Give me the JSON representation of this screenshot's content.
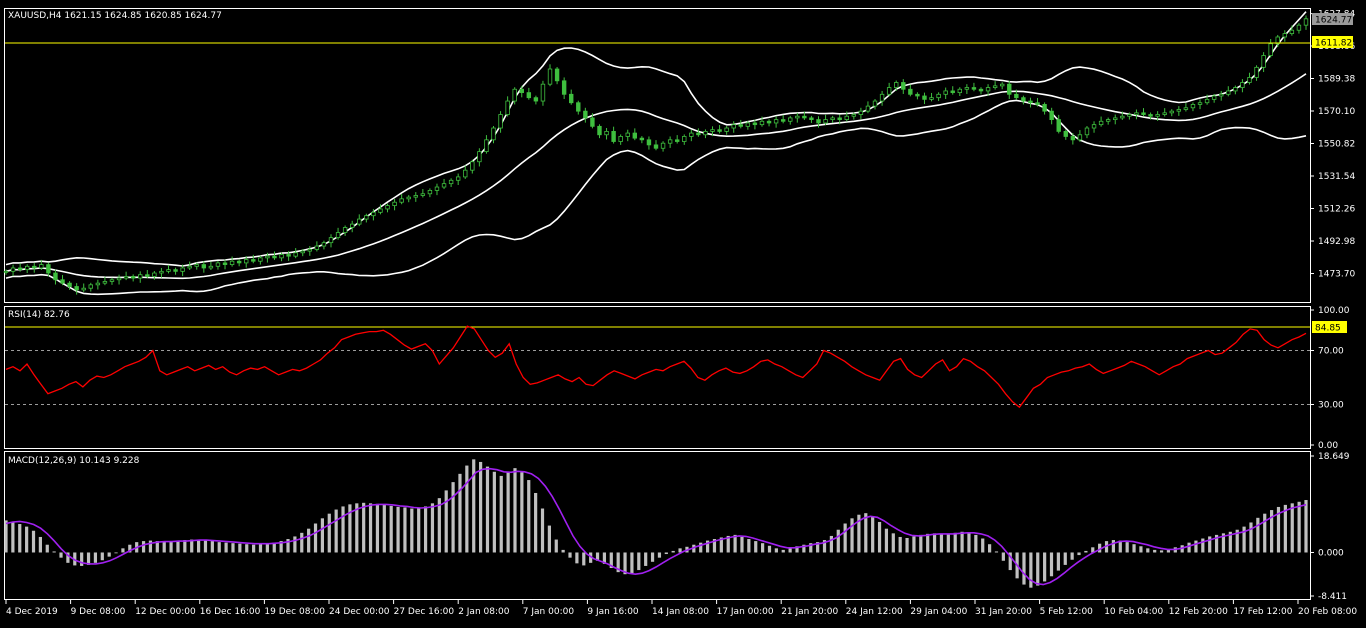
{
  "colors": {
    "background": "#000000",
    "candle": "#3fbf3f",
    "bands": "#ffffff",
    "rsi_line": "#ff0000",
    "level_line": "#ffff00",
    "macd_signal": "#a020f0",
    "macd_hist": "#c0c0c0"
  },
  "chart_data": [
    {
      "type": "candlestick",
      "title": "XAUUSD,H4  1621.15 1624.85 1620.85 1624.77",
      "last_price_label": "1624.77",
      "level_label": "1611.82",
      "yticks": [
        "1627.84",
        "1608.66",
        "1589.38",
        "1570.10",
        "1550.82",
        "1531.54",
        "1512.26",
        "1492.98",
        "1473.70"
      ],
      "ylim": [
        1458,
        1630
      ],
      "indicators": [
        "Bollinger Bands (upper, middle, lower)"
      ],
      "close": [
        1475,
        1477,
        1476,
        1478,
        1477,
        1479,
        1474,
        1470,
        1468,
        1466,
        1464,
        1465,
        1467,
        1468,
        1469,
        1470,
        1471,
        1472,
        1471,
        1473,
        1472,
        1474,
        1475,
        1476,
        1475,
        1477,
        1478,
        1479,
        1477,
        1478,
        1480,
        1479,
        1481,
        1480,
        1482,
        1481,
        1483,
        1484,
        1483,
        1485,
        1484,
        1486,
        1487,
        1488,
        1490,
        1492,
        1495,
        1498,
        1501,
        1503,
        1506,
        1508,
        1510,
        1512,
        1514,
        1516,
        1518,
        1519,
        1520,
        1521,
        1523,
        1525,
        1527,
        1529,
        1531,
        1535,
        1540,
        1546,
        1553,
        1560,
        1568,
        1576,
        1583,
        1581,
        1578,
        1576,
        1586,
        1595,
        1588,
        1580,
        1575,
        1570,
        1566,
        1561,
        1556,
        1558,
        1552,
        1555,
        1557,
        1554,
        1553,
        1550,
        1548,
        1551,
        1553,
        1552,
        1555,
        1557,
        1556,
        1558,
        1559,
        1558,
        1560,
        1562,
        1561,
        1563,
        1562,
        1564,
        1563,
        1565,
        1564,
        1566,
        1567,
        1566,
        1565,
        1563,
        1565,
        1566,
        1565,
        1567,
        1568,
        1570,
        1573,
        1576,
        1580,
        1584,
        1587,
        1583,
        1580,
        1579,
        1577,
        1578,
        1580,
        1582,
        1581,
        1583,
        1584,
        1583,
        1582,
        1584,
        1585,
        1586,
        1580,
        1578,
        1576,
        1575,
        1574,
        1570,
        1565,
        1558,
        1555,
        1553,
        1556,
        1560,
        1562,
        1564,
        1565,
        1566,
        1567,
        1568,
        1569,
        1568,
        1567,
        1568,
        1569,
        1570,
        1571,
        1572,
        1574,
        1575,
        1577,
        1579,
        1580,
        1582,
        1584,
        1587,
        1590,
        1596,
        1603,
        1610,
        1614,
        1616,
        1618,
        1621,
        1624.77
      ]
    },
    {
      "type": "line",
      "title": "RSI(14) 82.76",
      "level_label": "84.85",
      "yticks": [
        "100.00",
        "70.00",
        "30.00",
        "0.00"
      ],
      "ylim": [
        0,
        100
      ],
      "levels": [
        70,
        30
      ],
      "values": [
        56,
        58,
        55,
        60,
        52,
        45,
        38,
        40,
        42,
        45,
        47,
        43,
        48,
        51,
        50,
        52,
        55,
        58,
        60,
        62,
        65,
        70,
        55,
        52,
        54,
        56,
        58,
        55,
        57,
        59,
        56,
        58,
        54,
        52,
        55,
        57,
        56,
        58,
        55,
        52,
        54,
        56,
        55,
        57,
        60,
        63,
        68,
        72,
        78,
        80,
        82,
        83,
        84,
        84,
        85,
        82,
        78,
        74,
        71,
        73,
        75,
        70,
        60,
        66,
        72,
        80,
        88,
        86,
        78,
        70,
        65,
        68,
        75,
        60,
        50,
        45,
        46,
        48,
        50,
        52,
        49,
        47,
        50,
        45,
        44,
        48,
        52,
        55,
        53,
        51,
        49,
        52,
        54,
        56,
        55,
        58,
        60,
        62,
        57,
        50,
        48,
        52,
        55,
        57,
        54,
        53,
        55,
        58,
        62,
        63,
        60,
        58,
        55,
        52,
        50,
        55,
        60,
        70,
        68,
        65,
        62,
        58,
        55,
        52,
        50,
        48,
        55,
        62,
        64,
        56,
        52,
        50,
        55,
        60,
        63,
        55,
        58,
        64,
        62,
        58,
        55,
        50,
        45,
        38,
        32,
        28,
        35,
        42,
        45,
        50,
        52,
        54,
        55,
        57,
        58,
        60,
        56,
        53,
        55,
        57,
        59,
        62,
        60,
        58,
        55,
        52,
        55,
        58,
        60,
        64,
        66,
        68,
        70,
        67,
        68,
        72,
        76,
        82,
        86,
        85,
        78,
        74,
        72,
        75,
        78,
        80,
        82.76
      ]
    },
    {
      "type": "bar",
      "title": "MACD(12,26,9) 10.143 9.228",
      "yticks": [
        "18.649",
        "0.000",
        "-8.411"
      ],
      "ylim": [
        -8.411,
        18.649
      ],
      "series": [
        {
          "name": "MACD",
          "style": "histogram",
          "values": [
            6.2,
            5.8,
            5.5,
            5.0,
            4.2,
            3.0,
            1.5,
            0.2,
            -1.0,
            -2.0,
            -2.5,
            -2.6,
            -2.4,
            -2.0,
            -1.5,
            -0.8,
            0.0,
            0.8,
            1.5,
            2.0,
            2.2,
            2.3,
            2.2,
            2.1,
            2.2,
            2.3,
            2.4,
            2.5,
            2.4,
            2.3,
            2.2,
            2.0,
            1.9,
            1.8,
            1.7,
            1.6,
            1.5,
            1.6,
            1.7,
            1.9,
            2.2,
            2.6,
            3.1,
            3.8,
            4.6,
            5.6,
            6.6,
            7.5,
            8.3,
            8.9,
            9.3,
            9.5,
            9.6,
            9.5,
            9.4,
            9.2,
            9.0,
            8.8,
            8.7,
            8.5,
            8.6,
            8.9,
            9.5,
            10.5,
            12.0,
            13.6,
            15.2,
            16.8,
            18.0,
            17.5,
            16.6,
            15.6,
            14.8,
            15.6,
            16.3,
            15.5,
            14.0,
            11.5,
            8.5,
            5.2,
            2.5,
            0.5,
            -1.0,
            -2.1,
            -2.5,
            -2.0,
            -1.6,
            -2.2,
            -3.0,
            -3.8,
            -4.2,
            -4.0,
            -3.4,
            -2.6,
            -1.8,
            -1.0,
            -0.3,
            0.3,
            0.8,
            1.1,
            1.5,
            1.9,
            2.3,
            2.6,
            2.9,
            3.2,
            3.4,
            3.0,
            2.6,
            2.2,
            1.8,
            1.3,
            0.8,
            0.5,
            0.8,
            1.2,
            1.5,
            1.8,
            2.0,
            2.4,
            3.2,
            4.4,
            5.6,
            6.6,
            7.3,
            7.6,
            7.0,
            5.9,
            4.6,
            3.7,
            3.0,
            2.8,
            3.1,
            3.4,
            3.6,
            3.7,
            3.5,
            3.6,
            3.8,
            4.0,
            3.8,
            3.4,
            2.7,
            1.6,
            0.2,
            -1.6,
            -3.4,
            -5.0,
            -6.2,
            -6.8,
            -6.4,
            -5.6,
            -4.6,
            -3.5,
            -2.4,
            -1.4,
            -0.5,
            0.3,
            1.0,
            1.7,
            2.2,
            2.4,
            2.3,
            2.0,
            1.6,
            1.2,
            0.8,
            0.5,
            0.4,
            0.6,
            1.0,
            1.4,
            1.9,
            2.3,
            2.7,
            3.1,
            3.4,
            3.7,
            4.0,
            4.4,
            5.0,
            5.8,
            6.7,
            7.5,
            8.2,
            8.8,
            9.2,
            9.5,
            9.8,
            10.143
          ]
        },
        {
          "name": "Signal",
          "style": "line",
          "values": [
            5.6,
            5.9,
            6.0,
            5.8,
            5.4,
            4.7,
            3.6,
            2.2,
            0.7,
            -0.6,
            -1.5,
            -2.0,
            -2.2,
            -2.2,
            -2.0,
            -1.6,
            -1.0,
            -0.3,
            0.4,
            1.0,
            1.5,
            1.8,
            2.0,
            2.1,
            2.1,
            2.2,
            2.2,
            2.3,
            2.4,
            2.4,
            2.3,
            2.2,
            2.1,
            2.0,
            1.9,
            1.8,
            1.7,
            1.7,
            1.7,
            1.8,
            1.9,
            2.1,
            2.4,
            2.8,
            3.3,
            4.0,
            4.8,
            5.6,
            6.4,
            7.2,
            7.9,
            8.5,
            8.9,
            9.2,
            9.3,
            9.3,
            9.2,
            9.0,
            8.9,
            8.7,
            8.6,
            8.7,
            8.9,
            9.3,
            10.1,
            11.2,
            12.5,
            14.0,
            15.5,
            16.1,
            16.2,
            16.0,
            15.6,
            15.5,
            15.7,
            15.6,
            15.2,
            14.3,
            12.8,
            10.8,
            8.4,
            5.8,
            3.2,
            1.2,
            -0.3,
            -1.2,
            -1.7,
            -2.2,
            -2.9,
            -3.5,
            -4.0,
            -4.2,
            -4.0,
            -3.5,
            -2.8,
            -2.0,
            -1.2,
            -0.5,
            0.2,
            0.7,
            1.2,
            1.6,
            2.0,
            2.4,
            2.7,
            3.0,
            3.2,
            3.1,
            2.8,
            2.4,
            2.0,
            1.6,
            1.2,
            0.9,
            0.9,
            1.1,
            1.3,
            1.6,
            1.8,
            2.2,
            2.8,
            3.7,
            4.8,
            5.8,
            6.6,
            7.0,
            6.8,
            6.1,
            5.2,
            4.4,
            3.7,
            3.3,
            3.2,
            3.3,
            3.5,
            3.6,
            3.6,
            3.6,
            3.7,
            3.8,
            3.8,
            3.6,
            3.2,
            2.4,
            1.2,
            -0.4,
            -2.1,
            -3.8,
            -5.2,
            -6.0,
            -6.2,
            -5.8,
            -5.0,
            -4.0,
            -2.9,
            -1.9,
            -1.0,
            -0.2,
            0.5,
            1.2,
            1.7,
            2.1,
            2.2,
            2.1,
            1.8,
            1.5,
            1.1,
            0.8,
            0.6,
            0.6,
            0.8,
            1.2,
            1.6,
            2.0,
            2.4,
            2.8,
            3.1,
            3.4,
            3.7,
            4.0,
            4.5,
            5.2,
            6.0,
            6.8,
            7.5,
            8.1,
            8.6,
            8.9,
            9.228
          ]
        }
      ]
    }
  ],
  "time_labels": [
    "4 Dec 2019",
    "9 Dec 08:00",
    "12 Dec 00:00",
    "16 Dec 16:00",
    "19 Dec 08:00",
    "24 Dec 00:00",
    "27 Dec 16:00",
    "2 Jan 08:00",
    "7 Jan 00:00",
    "9 Jan 16:00",
    "14 Jan 08:00",
    "17 Jan 00:00",
    "21 Jan 20:00",
    "24 Jan 12:00",
    "29 Jan 04:00",
    "31 Jan 20:00",
    "5 Feb 12:00",
    "10 Feb 04:00",
    "12 Feb 20:00",
    "17 Feb 12:00",
    "20 Feb 08:00"
  ]
}
